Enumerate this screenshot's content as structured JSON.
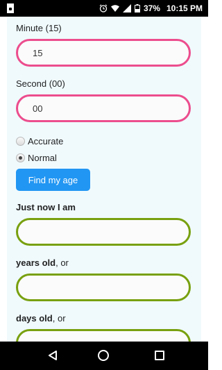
{
  "status_bar": {
    "battery": "37%",
    "time": "10:15 PM"
  },
  "form": {
    "minute": {
      "label": "Minute (15)",
      "value": "15"
    },
    "second": {
      "label": "Second (00)",
      "value": "00"
    },
    "radio_options": [
      {
        "label": "Accurate",
        "checked": false
      },
      {
        "label": "Normal",
        "checked": true
      }
    ],
    "button_label": "Find my age"
  },
  "results": {
    "just_now_label": "Just now I am",
    "years_label_bold": "years old",
    "years_label_rest": ", or",
    "days_label_bold": "days old",
    "days_label_rest": ", or"
  },
  "colors": {
    "pink_border": "#ec4d8d",
    "green_border": "#78a00f",
    "button": "#2196f3",
    "content_bg": "#f0fafd"
  },
  "icons": {
    "status": [
      "notification-icon",
      "alarm-icon",
      "wifi-icon",
      "signal-icon",
      "battery-icon"
    ],
    "nav": [
      "back-icon",
      "home-icon",
      "recents-icon"
    ]
  }
}
